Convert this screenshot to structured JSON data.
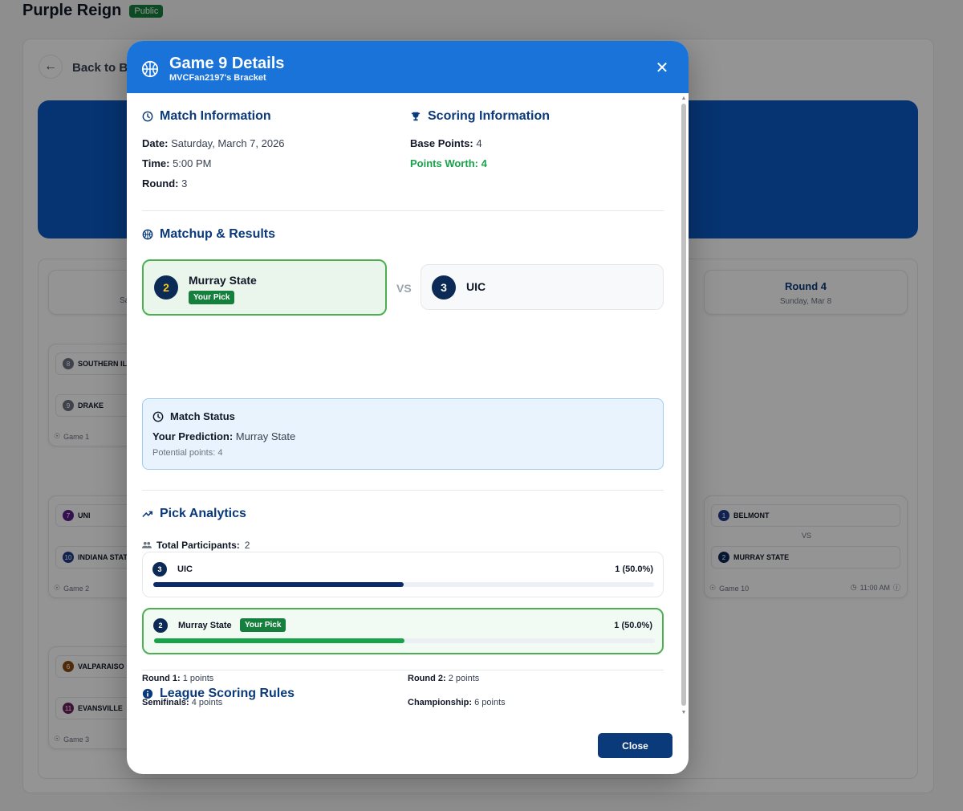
{
  "background": {
    "title": "Purple Reign",
    "badge": "Public",
    "back_label": "Back to Bra",
    "round4": {
      "title": "Round 4",
      "date": "Sunday, Mar 8"
    },
    "round1_partial_date": "Sa",
    "game1": {
      "team1_seed": "8",
      "team1": "SOUTHERN ILL",
      "team2_seed": "9",
      "team2": "DRAKE",
      "label": "Game 1"
    },
    "game2": {
      "team1_seed": "7",
      "team1": "UNI",
      "team2_seed": "10",
      "team2": "INDIANA STATE",
      "label": "Game 2"
    },
    "game3": {
      "team1_seed": "6",
      "team1": "VALPARAISO",
      "team2_seed": "11",
      "team2": "EVANSVILLE",
      "label": "Game 3"
    },
    "game10": {
      "team1_seed": "1",
      "team1": "BELMONT",
      "vs": "VS",
      "team2_seed": "2",
      "team2": "MURRAY STATE",
      "label": "Game 10",
      "time": "11:00 AM"
    }
  },
  "modal": {
    "title": "Game 9 Details",
    "subtitle": "MVCFan2197's Bracket",
    "match_info": {
      "heading": "Match Information",
      "date_label": "Date:",
      "date": "Saturday, March 7, 2026",
      "time_label": "Time:",
      "time": "5:00 PM",
      "round_label": "Round:",
      "round": "3"
    },
    "scoring_info": {
      "heading": "Scoring Information",
      "base_label": "Base Points:",
      "base": "4",
      "worth_text": "Points Worth: 4"
    },
    "matchup": {
      "heading": "Matchup & Results",
      "team1_seed": "2",
      "team1": "Murray State",
      "pick_badge": "Your Pick",
      "vs": "VS",
      "team2_seed": "3",
      "team2": "UIC"
    },
    "status": {
      "heading": "Match Status",
      "prediction_label": "Your Prediction:",
      "prediction": "Murray State",
      "potential": "Potential points: 4"
    },
    "analytics": {
      "heading": "Pick Analytics",
      "participants_label": "Total Participants:",
      "participants": "2",
      "picks": [
        {
          "seed": "3",
          "team": "UIC",
          "count": "1 (50.0%)",
          "share": 0.5,
          "your_pick": false
        },
        {
          "seed": "2",
          "team": "Murray State",
          "badge": "Your Pick",
          "count": "1 (50.0%)",
          "share": 0.5,
          "your_pick": true
        }
      ]
    },
    "rules": {
      "heading": "League Scoring Rules",
      "r1_label": "Round 1:",
      "r1": "1 points",
      "r2_label": "Round 2:",
      "r2": "2 points",
      "semi_label": "Semifinals:",
      "semi": "4 points",
      "champ_label": "Championship:",
      "champ": "6 points"
    },
    "close_label": "Close"
  },
  "colors": {
    "header_blue": "#1a73d9",
    "navy": "#0b3a7a",
    "green": "#16a34a"
  }
}
